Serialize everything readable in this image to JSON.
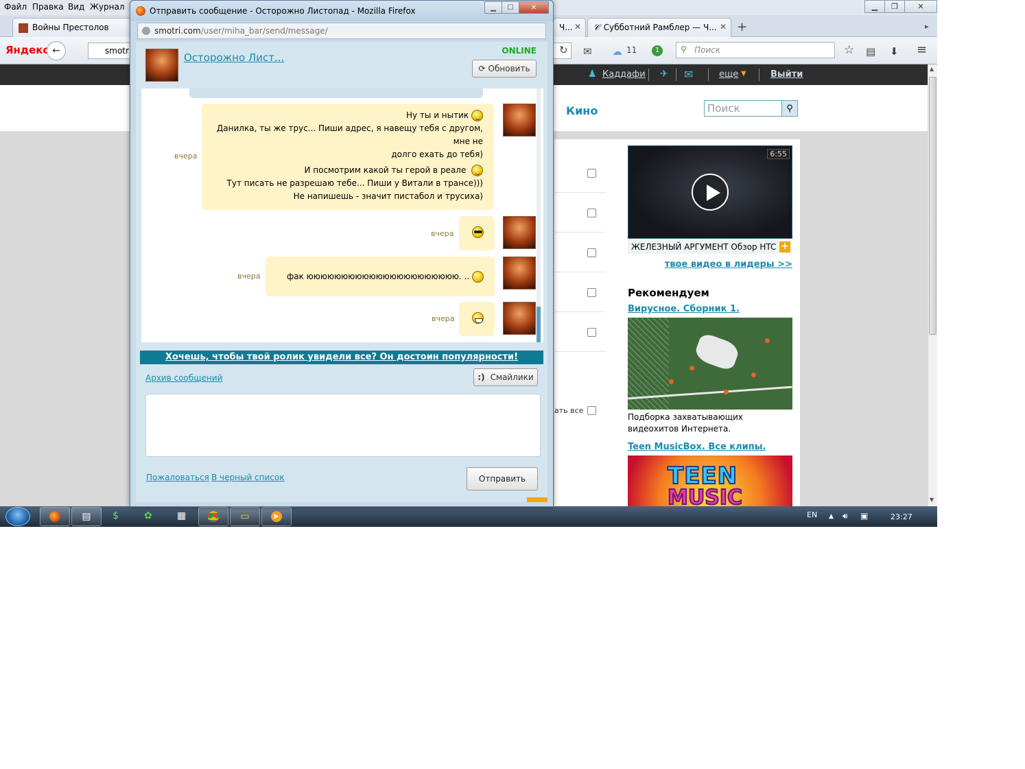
{
  "background_browser": {
    "menu": [
      "Файл",
      "Правка",
      "Вид",
      "Журнал"
    ],
    "tabs": [
      {
        "label": "Войны Престолов"
      },
      {
        "label": "Ч..."
      },
      {
        "label": "Субботний Рамблер — Ч..."
      }
    ],
    "yandex_logo": "Яндекс",
    "url_prefix": "smotri.",
    "search_placeholder": "Поиск",
    "cloud_count": "11",
    "badge_count": "1"
  },
  "site": {
    "topbar": {
      "user_link": "Каддафи",
      "more_label": "еще",
      "logout_label": "Выйти"
    },
    "nav_kino": "Кино",
    "search_placeholder": "Поиск",
    "mark_all_label": "ать все",
    "video": {
      "duration": "6:55",
      "title": "ЖЕЛЕЗНЫЙ АРГУМЕНТ Обзор HTC"
    },
    "leaders_link": "твое видео в лидеры >>",
    "recommend_heading": "Рекомендуем",
    "rec1": {
      "title": "Вирусное. Сборник 1.",
      "desc": "Подборка захватывающих видеохитов Интернета."
    },
    "rec2": {
      "title": "Teen MusicBox. Все клипы.",
      "logo_line1": "TEEN",
      "logo_line2": "MUSIC"
    }
  },
  "popup": {
    "window_title": "Отправить сообщение - Осторожно Листопад - Mozilla Firefox",
    "url_host": "smotri.com",
    "url_path": "/user/miha_bar/send/message/",
    "contact_name": "Осторожно Лист...",
    "status": "ONLINE",
    "refresh_label": "Обновить",
    "messages": [
      {
        "time": "вчера",
        "lines": [
          "Ну ты и нытик",
          "Данилка, ты же трус... Пиши адрес, я навещу тебя с другом, мне не",
          "долго ехать до тебя)",
          "И посмотрим какой ты герой в реале",
          "Тут писать не разрешаю тебе... Пиши у Витали в трансе)))",
          "Не напишешь - значит пистабол и трусиха)"
        ]
      },
      {
        "time": "вчера",
        "text": ""
      },
      {
        "time": "вчера",
        "text": "фак юююююююююююююююююююююю. .."
      },
      {
        "time": "вчера",
        "text": ""
      }
    ],
    "promo": "Хочешь, чтобы твой ролик увидели все? Он достоин популярности!",
    "archive_link": "Архив сообщений",
    "smilies_label": "Смайлики",
    "smilies_glyph": ":)",
    "complain_link": "Пожаловаться",
    "blacklist_link": "В черный список",
    "send_label": "Отправить"
  },
  "taskbar": {
    "lang": "EN",
    "clock": "23:27"
  }
}
